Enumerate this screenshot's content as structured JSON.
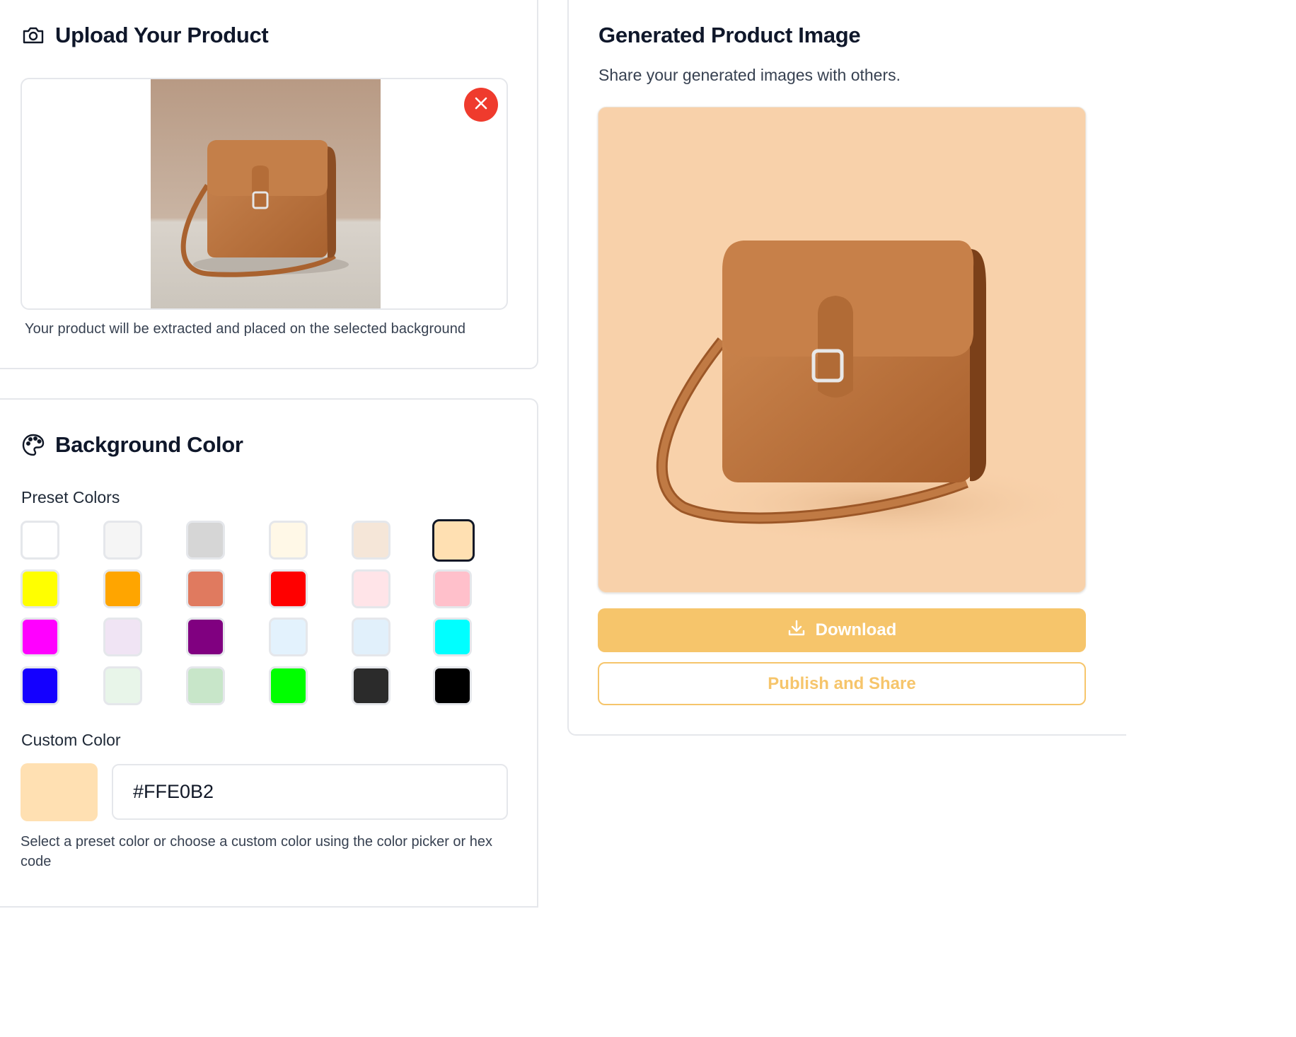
{
  "upload": {
    "title": "Upload Your Product",
    "hint": "Your product will be extracted and placed on the selected background"
  },
  "background": {
    "title": "Background Color",
    "preset_label": "Preset Colors",
    "presets": [
      "#FFFFFF",
      "#F5F5F5",
      "#D6D6D6",
      "#FFF8E7",
      "#F5E6D8",
      "#FFE0B2",
      "#FFFF00",
      "#FFA500",
      "#E07A5F",
      "#FF0000",
      "#FFE4E8",
      "#FFC0CB",
      "#FF00FF",
      "#F0E4F4",
      "#800080",
      "#E3F2FD",
      "#E1F0FB",
      "#00FFFF",
      "#1400FF",
      "#E8F5E9",
      "#C8E6C9",
      "#00FF00",
      "#2B2B2B",
      "#000000"
    ],
    "selected": "#FFE0B2",
    "custom_label": "Custom Color",
    "custom_value": "#FFE0B2",
    "custom_hint": "Select a preset color or choose a custom color using the color picker or hex code"
  },
  "generated": {
    "title": "Generated Product Image",
    "subtitle": "Share your generated images with others.",
    "download_label": "Download",
    "publish_label": "Publish and Share"
  },
  "colors": {
    "accent": "#F6C56B",
    "remove": "#EF3B2D",
    "generated_bg": "#F8D1AA"
  },
  "icons": {
    "upload": "camera-icon",
    "background": "palette-icon",
    "remove": "close-icon",
    "download": "download-icon"
  }
}
